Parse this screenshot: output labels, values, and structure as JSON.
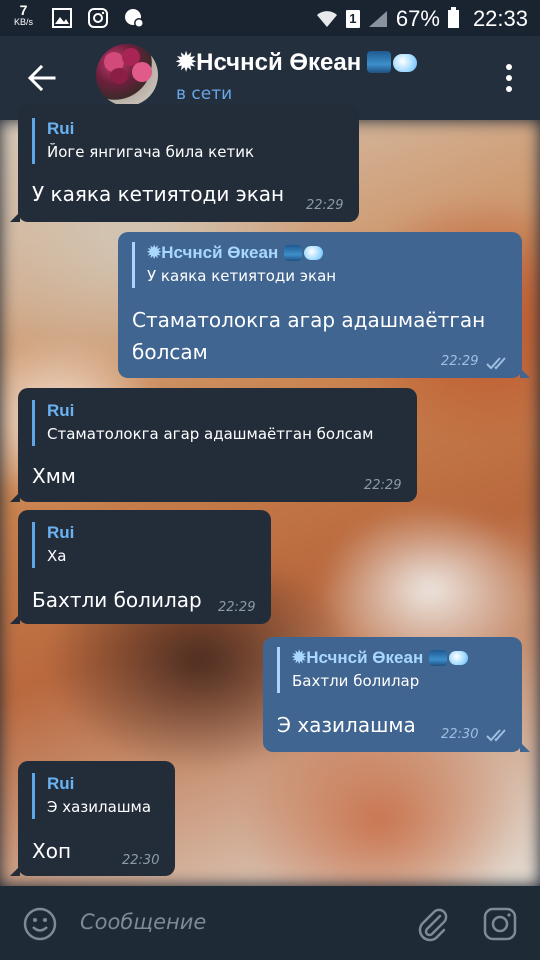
{
  "status_bar": {
    "speed_value": "7",
    "speed_unit": "KB/s",
    "sim_label": "1",
    "battery": "67%",
    "time": "22:33"
  },
  "header": {
    "title": "✹Нсчнсй Өкеан",
    "status": "в сети"
  },
  "messages": [
    {
      "direction": "in",
      "reply_name": "Rui",
      "reply_text": "Йоге янгигача била кетик",
      "text": "У каяка кетиятоди экан",
      "time": "22:29"
    },
    {
      "direction": "out",
      "reply_name": "✹Нсчнсй Өкеан",
      "reply_text": "У каяка кетиятоди экан",
      "text_line1": "Стаматолокга агар адашмаётган",
      "text_line2": "болсам",
      "time": "22:29"
    },
    {
      "direction": "in",
      "reply_name": "Rui",
      "reply_text": "Стаматолокга агар адашмаётган болсам",
      "text": "Хмм",
      "time": "22:29"
    },
    {
      "direction": "in",
      "reply_name": "Rui",
      "reply_text": "Ха",
      "text": "Бахтли болилар",
      "time": "22:29"
    },
    {
      "direction": "out",
      "reply_name": "✹Нсчнсй Өкеан",
      "reply_text": "Бахтли болилар",
      "text": "Э хазилашма",
      "time": "22:30"
    },
    {
      "direction": "in",
      "reply_name": "Rui",
      "reply_text": "Э хазилашма",
      "text": "Хоп",
      "time": "22:30"
    }
  ],
  "input": {
    "placeholder": "Сообщение"
  },
  "colors": {
    "header_bg": "#242f3d",
    "incoming_bubble": "#232d3a",
    "outgoing_bubble": "#406590",
    "accent": "#6ab2f2"
  }
}
